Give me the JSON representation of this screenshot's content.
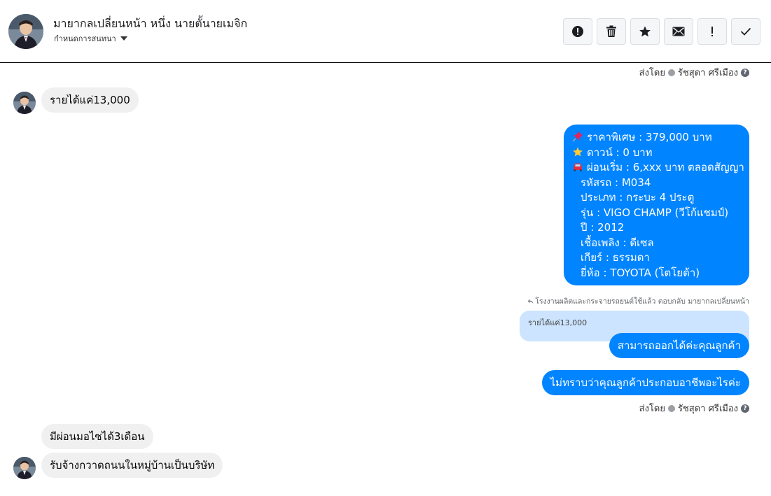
{
  "header": {
    "title": "มายากลเปลี่ยนหน้า หนึ่ง นายตั้นายเมจิก",
    "subtitle": "กำหนดการสนทนา",
    "actions": [
      {
        "icon": "alert-circle-icon",
        "name": "report-button"
      },
      {
        "icon": "trash-icon",
        "name": "delete-button"
      },
      {
        "icon": "star-icon",
        "name": "star-button"
      },
      {
        "icon": "envelope-icon",
        "name": "mark-unread-button"
      },
      {
        "icon": "exclamation-icon",
        "name": "spam-button"
      },
      {
        "icon": "check-icon",
        "name": "done-button"
      }
    ]
  },
  "sent_by_top": {
    "label": "ส่งโดย",
    "name": "รัชสุดา ศรีเมือง"
  },
  "sent_by_bottom": {
    "label": "ส่งโดย",
    "name": "รัชสุดา ศรีเมือง"
  },
  "messages": {
    "in_1": "รายได้แค่13,000",
    "card": {
      "lines": [
        {
          "icon": "pushpin-icon",
          "text": "ราคาพิเศษ : 379,000 บาท"
        },
        {
          "icon": "star-emoji-icon",
          "text": "ดาวน์ : 0 บาท"
        },
        {
          "icon": "car-icon",
          "text": "ผ่อนเริ่ม : 6,xxx บาท ตลอดสัญญา"
        },
        {
          "text": "รหัสรถ : M034"
        },
        {
          "text": "ประเภท : กระบะ 4 ประตู"
        },
        {
          "text": "รุ่น : VIGO CHAMP (วีโก้แชมป์)"
        },
        {
          "text": "ปี : 2012"
        },
        {
          "text": "เชื้อเพลิง : ดีเซล"
        },
        {
          "text": "เกียร์ : ธรรมดา"
        },
        {
          "text": "ยี่ห้อ : TOYOTA (โตโยต้า)"
        }
      ]
    },
    "reply_note": "โรงงานผลิตและกระจายรถยนต์ใช้แล้ว ตอบกลับ มายากลเปลี่ยนหน้า",
    "reply_quote": "รายได้แค่13,000",
    "out_1": "สามารถออกได้ค่ะคุณลูกค้า",
    "out_2": "ไม่ทราบว่าคุณลูกค้าประกอบอาชีพอะไรค่ะ",
    "in_2": "มีผ่อนมอไซได้3เดือน",
    "in_3": "รับจ้างกวาดถนนในหมู่บ้านเป็นบริษัท"
  },
  "colors": {
    "outgoing_bubble": "#0084ff",
    "incoming_bubble": "#f0f0f0",
    "reply_quote_bg": "#cce4ff"
  }
}
